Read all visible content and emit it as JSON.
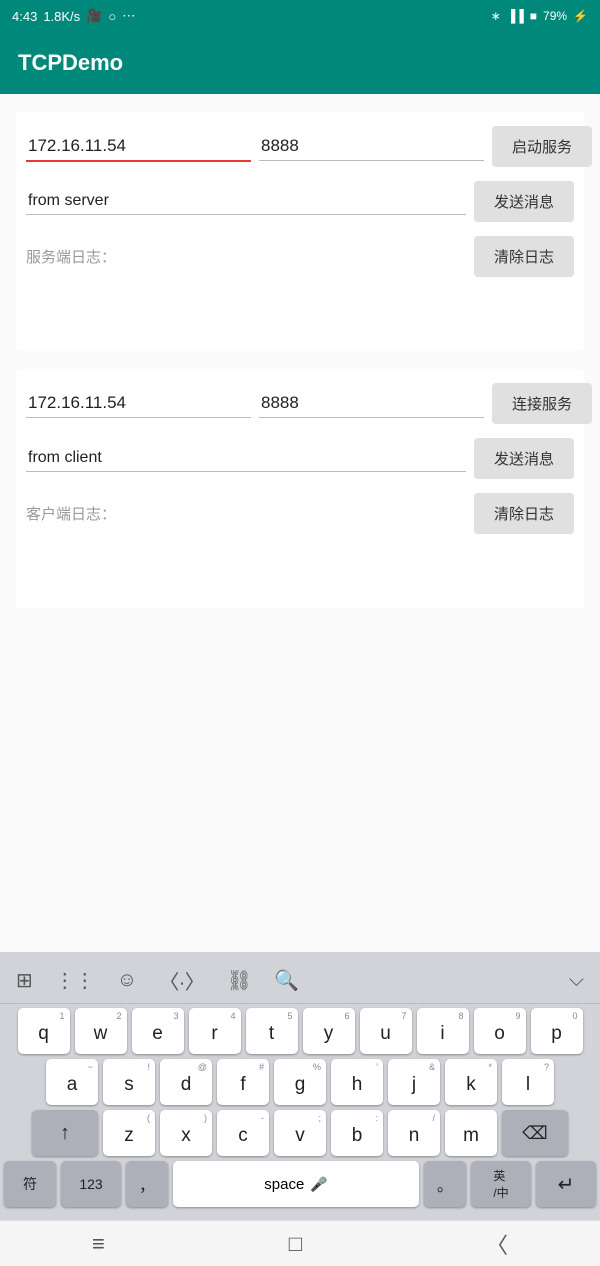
{
  "statusBar": {
    "time": "4:43",
    "speed": "1.8K/s",
    "battery": "79"
  },
  "appBar": {
    "title": "TCPDemo"
  },
  "serverSection": {
    "ip": "172.16.11.54",
    "port": "8888",
    "startBtn": "启动服务",
    "message": "from server",
    "sendBtn": "发送消息",
    "logLabel": "服务端日志：",
    "clearBtn": "清除日志"
  },
  "clientSection": {
    "ip": "172.16.11.54",
    "port": "8888",
    "connectBtn": "连接服务",
    "message": "from client",
    "sendBtn": "发送消息",
    "logLabel": "客户端日志：",
    "clearBtn": "清除日志"
  },
  "keyboard": {
    "rows": [
      [
        {
          "num": "1",
          "char": "q"
        },
        {
          "num": "2",
          "char": "w"
        },
        {
          "num": "3",
          "char": "e"
        },
        {
          "num": "4",
          "char": "r"
        },
        {
          "num": "5",
          "char": "t"
        },
        {
          "num": "6",
          "char": "y"
        },
        {
          "num": "7",
          "char": "u"
        },
        {
          "num": "8",
          "char": "i"
        },
        {
          "num": "9",
          "char": "o"
        },
        {
          "num": "0",
          "char": "p"
        }
      ],
      [
        {
          "num": "~",
          "char": "a"
        },
        {
          "num": "!",
          "char": "s"
        },
        {
          "num": "@",
          "char": "d"
        },
        {
          "num": "#",
          "char": "f"
        },
        {
          "num": "%",
          "char": "g"
        },
        {
          "num": "'",
          "char": "h"
        },
        {
          "num": "&",
          "char": "j"
        },
        {
          "num": "*",
          "char": "k"
        },
        {
          "num": "?",
          "char": "l"
        }
      ],
      [
        {
          "num": "(",
          "char": "z"
        },
        {
          "num": ")",
          "char": "x"
        },
        {
          "num": "-",
          "char": "c"
        },
        {
          "num": ";",
          "char": "v"
        },
        {
          "num": ":",
          "char": "b"
        },
        {
          "num": "/",
          "char": "n"
        },
        {
          "num": "",
          "char": "m"
        }
      ]
    ],
    "specialKeys": {
      "shift": "↑",
      "delete": "⌫",
      "fu": "符",
      "num123": "123",
      "comma": "，",
      "space": "space",
      "period": "。",
      "lang": "英/中",
      "enter": "↵"
    }
  }
}
